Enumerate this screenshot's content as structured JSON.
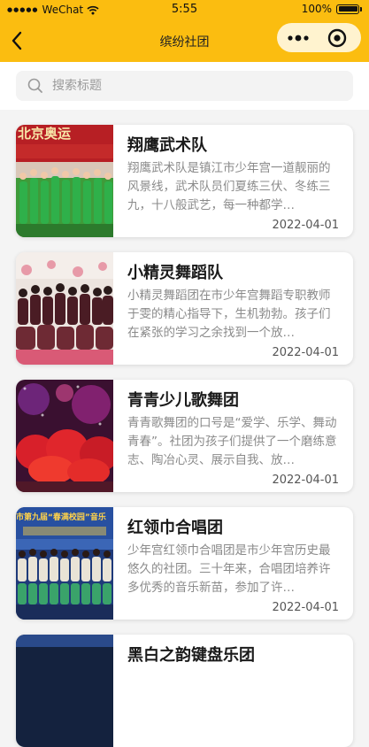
{
  "status_bar": {
    "carrier": "WeChat",
    "time": "5:55",
    "battery": "100%"
  },
  "nav": {
    "title": "缤纷社团"
  },
  "search": {
    "placeholder": "搜索标题"
  },
  "items": [
    {
      "title": "翔鹰武术队",
      "desc": "翔鹰武术队是镇江市少年宫一道靓丽的风景线，武术队员们夏练三伏、冬练三九，十八般武艺，每一种都学…",
      "date": "2022-04-01"
    },
    {
      "title": "小精灵舞蹈队",
      "desc": "小精灵舞蹈团在市少年宫舞蹈专职教师于雯的精心指导下，生机勃勃。孩子们在紧张的学习之余找到一个放…",
      "date": "2022-04-01"
    },
    {
      "title": "青青少儿歌舞团",
      "desc": "青青歌舞团的口号是“爱学、乐学、舞动青春”。社团为孩子们提供了一个磨练意志、陶冶心灵、展示自我、放…",
      "date": "2022-04-01"
    },
    {
      "title": "红领巾合唱团",
      "desc": "少年宫红领巾合唱团是市少年宫历史最悠久的社团。三十年来，合唱团培养许多优秀的音乐新苗，参加了许…",
      "date": "2022-04-01"
    },
    {
      "title": "黑白之韵键盘乐团",
      "desc": "",
      "date": ""
    }
  ],
  "thumb_texts": {
    "item0": "北京奥运",
    "item3": "市第九届“春满校园”音乐"
  },
  "colors": {
    "accent": "#fbbd10",
    "capsule": "#fff3cf"
  }
}
